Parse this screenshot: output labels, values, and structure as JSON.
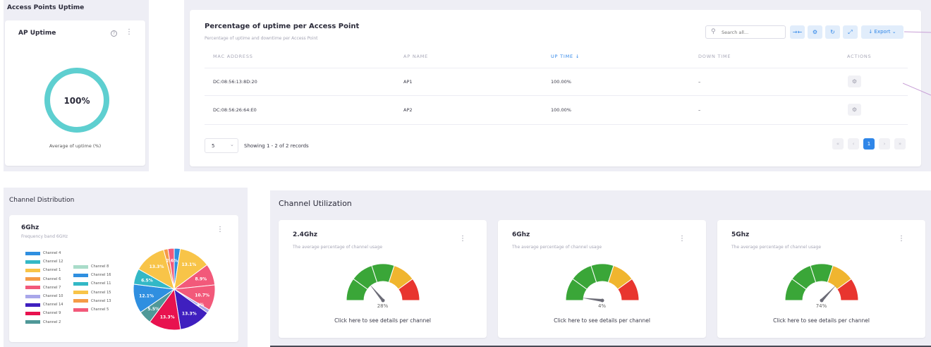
{
  "ap_uptime_section": {
    "title": "Access Points Uptime",
    "card_title": "AP Uptime",
    "value": "100%",
    "percent": 100,
    "caption": "Average of uptime (%)",
    "ring_color": "#5ecfd0"
  },
  "uptime_table": {
    "title": "Percentage of uptime per Access Point",
    "subtitle": "Percentage of uptime and downtime per Access Point",
    "search_placeholder": "Search all...",
    "export_label": "Export",
    "columns": [
      "MAC ADDRESS",
      "AP NAME",
      "UP TIME",
      "DOWN TIME",
      "ACTIONS"
    ],
    "sort_indicator": "↓",
    "rows": [
      {
        "mac": "DC:08:56:13:8D:20",
        "ap": "AP1",
        "up": "100.00%",
        "down": "–"
      },
      {
        "mac": "DC:08:56:26:64:E0",
        "ap": "AP2",
        "up": "100.00%",
        "down": "–"
      }
    ],
    "page_size": "5",
    "records_text": "Showing 1 - 2 of 2 records",
    "current_page": "1",
    "accent": "#2f86e8"
  },
  "channel_distribution": {
    "section_title": "Channel Distribution",
    "card_title": "6Ghz",
    "card_subtitle": "Frequency band 6GHz",
    "legend_left": [
      {
        "name": "Channel 4",
        "color": "#2f8fe0"
      },
      {
        "name": "Channel 12",
        "color": "#33b8c6"
      },
      {
        "name": "Channel 1",
        "color": "#f8c448"
      },
      {
        "name": "Channel 6",
        "color": "#f59b46"
      },
      {
        "name": "Channel 7",
        "color": "#f2597a"
      },
      {
        "name": "Channel 10",
        "color": "#a9a7ea"
      },
      {
        "name": "Channel 14",
        "color": "#3f1fbf"
      },
      {
        "name": "Channel 9",
        "color": "#e8124f"
      },
      {
        "name": "Channel 2",
        "color": "#4f9898"
      }
    ],
    "legend_right": [
      {
        "name": "Channel 8",
        "color": "#a9dcc9"
      },
      {
        "name": "Channel 16",
        "color": "#2f8fe0"
      },
      {
        "name": "Channel 11",
        "color": "#33b8c6"
      },
      {
        "name": "Channel 15",
        "color": "#f8c448"
      },
      {
        "name": "Channel 13",
        "color": "#f59b46"
      },
      {
        "name": "Channel 5",
        "color": "#f2597a"
      }
    ]
  },
  "chart_data": {
    "type": "pie",
    "slices": [
      {
        "name": "Channel 4",
        "value": 2.5,
        "color": "#2f8fe0",
        "label": ""
      },
      {
        "name": "Channel 15",
        "value": 13.1,
        "color": "#f8c448",
        "label": "13.1%"
      },
      {
        "name": "Channel 5",
        "value": 8.9,
        "color": "#f2597a",
        "label": "8.9%"
      },
      {
        "name": "Channel 7",
        "value": 10.7,
        "color": "#f2597a",
        "label": "10.7%"
      },
      {
        "name": "Channel 10",
        "value": 1.4,
        "color": "#a9a7ea",
        "label": "1.4%"
      },
      {
        "name": "Channel 14",
        "value": 13.3,
        "color": "#3f1fbf",
        "label": "13.3%"
      },
      {
        "name": "Channel 9",
        "value": 13.3,
        "color": "#e8124f",
        "label": "13.3%"
      },
      {
        "name": "Channel 2",
        "value": 5.5,
        "color": "#4f9898",
        "label": "5.5%"
      },
      {
        "name": "Channel 16",
        "value": 12.1,
        "color": "#2f8fe0",
        "label": "12.1%"
      },
      {
        "name": "Channel 11",
        "value": 6.5,
        "color": "#33b8c6",
        "label": "6.5%"
      },
      {
        "name": "Channel 1",
        "value": 13.3,
        "color": "#f8c448",
        "label": "13.3%"
      },
      {
        "name": "Channel 13",
        "value": 1.8,
        "color": "#f59b46",
        "label": ""
      },
      {
        "name": "Channel 6",
        "value": 2.6,
        "color": "#f2597a",
        "label": "2.6%"
      }
    ]
  },
  "channel_utilization": {
    "section_title": "Channel Utilization",
    "gauge_subtitle": "The average percentage of channel usage",
    "link_text": "Click here to see details per channel",
    "zone_colors": [
      "#3aa638",
      "#f0b52f",
      "#e8352f"
    ],
    "gauges": [
      {
        "title": "2.4Ghz",
        "value": 28,
        "value_label": "28%"
      },
      {
        "title": "6Ghz",
        "value": 4,
        "value_label": "4%"
      },
      {
        "title": "5Ghz",
        "value": 74,
        "value_label": "74%"
      }
    ]
  }
}
